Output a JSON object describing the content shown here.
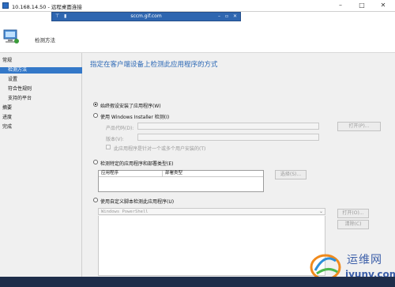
{
  "window": {
    "title": "10.168.14.50 - 远程桌面连接",
    "controls": [
      "–",
      "□",
      "✕"
    ]
  },
  "connection_bar": {
    "host": "sccm.gif.com",
    "icons": [
      "pin-icon",
      "signal-icon"
    ]
  },
  "wizard": {
    "title": "检测方法",
    "nav": [
      "常规",
      "检测方法",
      "设置",
      "符合性规则",
      "支持的平台",
      "摘要",
      "进度",
      "完成"
    ],
    "selected_nav": "检测方法"
  },
  "content": {
    "heading": "指定在客户端设备上检测此应用程序的方式",
    "option1": "始终假设安装了应用程序(W)",
    "option2": "使用 Windows Installer 检测(I)",
    "product_code_label": "产品代码(D):",
    "version_label": "版本(V):",
    "per_user_label": "此应用程序是针对一个或多个用户安装的(T)",
    "browse_label": "打开(P)...",
    "option3": "检测特定的应用程序和部署类型(E)",
    "table_columns": [
      "应用程序",
      "部署类型"
    ],
    "select_label": "选择(S)...",
    "option4": "使用自定义脚本检测此应用程序(U)",
    "script_type": "Windows PowerShell",
    "open_label": "打开(O)...",
    "clear_label": "清除(C)"
  },
  "watermark": {
    "text": "运维网",
    "url": "iyunv.com"
  },
  "colors": {
    "accent": "#3478c8",
    "heading": "#2a67b5",
    "rdp_bar": "#2e66b0"
  }
}
